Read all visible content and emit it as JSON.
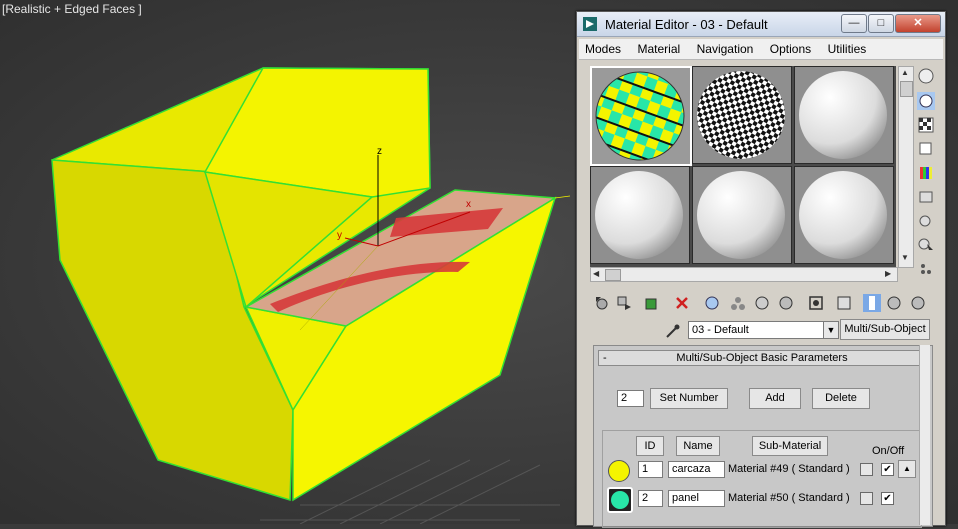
{
  "viewport": {
    "label": "[Realistic + Edged Faces ]",
    "axis_x": "x",
    "axis_y": "y",
    "axis_z": "z"
  },
  "material_editor": {
    "title": "Material Editor - 03 - Default",
    "window_buttons": {
      "minimize": "—",
      "maximize": "□",
      "close": "✕"
    },
    "menu": [
      "Modes",
      "Material",
      "Navigation",
      "Options",
      "Utilities"
    ],
    "material_name": "03 - Default",
    "material_type": "Multi/Sub-Object",
    "rollout": {
      "title": "Multi/Sub-Object Basic Parameters",
      "collapse": "-",
      "count": "2",
      "set_number": "Set Number",
      "add": "Add",
      "delete": "Delete",
      "col_id": "ID",
      "col_name": "Name",
      "col_submaterial": "Sub-Material",
      "col_onoff": "On/Off",
      "rows": [
        {
          "id": "1",
          "name": "carcaza",
          "submaterial": "Material #49  ( Standard )",
          "color": "#f4f400",
          "on": true
        },
        {
          "id": "2",
          "name": "panel",
          "submaterial": "Material #50  ( Standard )",
          "color": "#28e6a8",
          "on": true
        }
      ]
    }
  }
}
